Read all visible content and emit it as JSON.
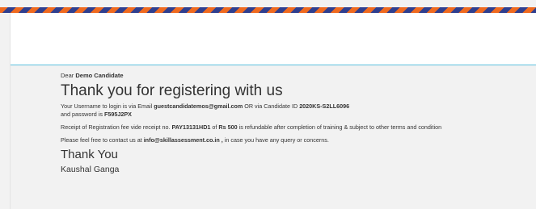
{
  "colors": {
    "stripe_orange": "#ef6a1f",
    "stripe_blue": "#2f3f8f",
    "header_rule": "#5bc0de",
    "text": "#333333"
  },
  "email": {
    "greeting_prefix": "Dear",
    "candidate_name": "Demo Candidate",
    "heading": "Thank you for registering with us",
    "login": {
      "prefix": "Your Username to login is via Email",
      "email": "guestcandidatemos@gmail.com",
      "middle": "OR via Candidate ID",
      "candidate_id": "2020KS-S2LL6096",
      "password_prefix": "and password is",
      "password": "F595J2PX"
    },
    "receipt": {
      "prefix": "Receipt of Registration fee vide receipt no.",
      "receipt_no": "PAY13131HD1",
      "of": "of",
      "amount": "Rs 500",
      "suffix": "is refundable after completion of training & subject to other terms and condition"
    },
    "contact": {
      "prefix": "Please feel free to contact us at",
      "email": "info@skillassessment.co.in ,",
      "suffix": "in case you have any query or concerns."
    },
    "closing": "Thank You",
    "signature": "Kaushal Ganga"
  }
}
